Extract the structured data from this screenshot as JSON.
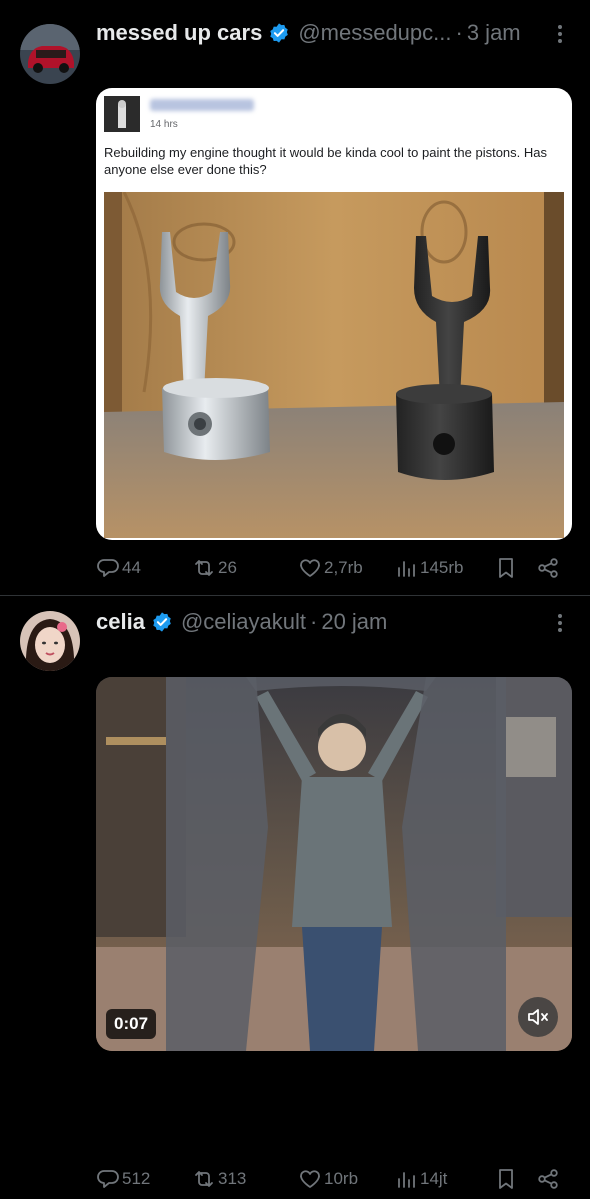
{
  "colors": {
    "background": "#000000",
    "text_primary": "#e7e9ea",
    "text_secondary": "#71767b",
    "verified_blue": "#1d9bf0",
    "separator": "#2f3336"
  },
  "tweets": [
    {
      "display_name": "messed up cars",
      "handle": "@messedupc...",
      "dot": "·",
      "time": "3 jam",
      "verified_icon": "verified-badge-icon",
      "more_icon": "more-vertical-icon",
      "embedded_post": {
        "time": "14 hrs",
        "text": "Rebuilding my engine thought it would be kinda cool to paint the pistons. Has anyone else ever done this?"
      },
      "stats": {
        "replies": "44",
        "retweets": "26",
        "likes": "2,7rb",
        "views": "145rb"
      }
    },
    {
      "display_name": "celia",
      "handle": "@celiayakult",
      "dot": "·",
      "time": "20 jam",
      "verified_icon": "verified-badge-icon",
      "more_icon": "more-vertical-icon",
      "video": {
        "duration": "0:07",
        "mute_icon": "volume-muted-icon"
      },
      "stats": {
        "replies": "512",
        "retweets": "313",
        "likes": "10rb",
        "views": "14jt"
      }
    }
  ]
}
